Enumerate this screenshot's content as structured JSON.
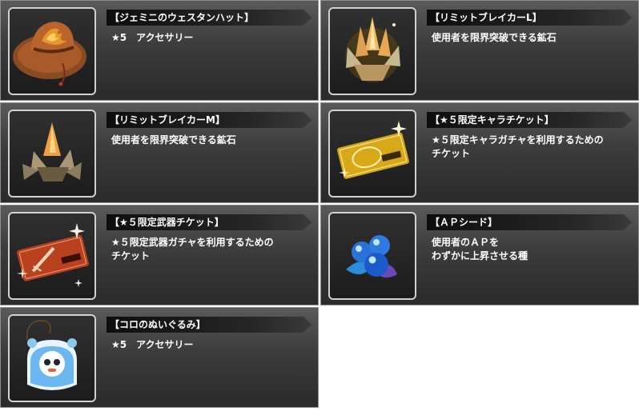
{
  "items": [
    {
      "title": "【ジェミニのウェスタンハット】",
      "description": "★5　アクセサリー",
      "icon": "western-hat-icon"
    },
    {
      "title": "【リミットブレイカーL】",
      "description": "使用者を限界突破できる鉱石",
      "icon": "crystal-large-icon"
    },
    {
      "title": "【リミットブレイカーM】",
      "description": "使用者を限界突破できる鉱石",
      "icon": "crystal-medium-icon"
    },
    {
      "title": "【★５限定キャラチケット】",
      "description": "★５限定キャラガチャを利用するための\nチケット",
      "icon": "gold-ticket-icon"
    },
    {
      "title": "【★５限定武器チケット】",
      "description": "★５限定武器ガチャを利用するための\nチケット",
      "icon": "red-ticket-icon"
    },
    {
      "title": "【ＡＰシード】",
      "description": "使用者のＡＰを\nわずかに上昇させる種",
      "icon": "ap-seed-icon"
    },
    {
      "title": "【コロのぬいぐるみ】",
      "description": "★5　アクセサリー",
      "icon": "plush-doll-icon"
    }
  ],
  "colors": {
    "card_top": "#5a5a5a",
    "card_bottom": "#2a2a2a",
    "card_border": "#8e8e8e",
    "text": "#ffffff"
  }
}
